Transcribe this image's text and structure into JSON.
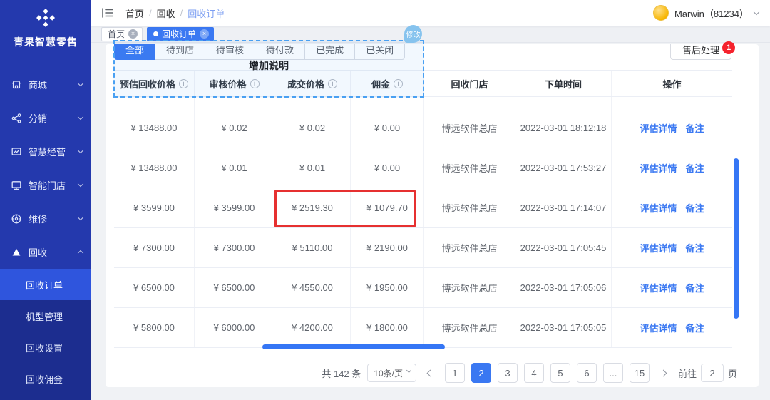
{
  "colors": {
    "accent": "#3a78f2",
    "sidebar_bg": "#2439ad",
    "sidebar_submenu_bg": "#1c2d8f",
    "sidebar_active_bg": "#2f55dd",
    "danger": "#f5222d",
    "annotation_blue": "#49a0f2",
    "annotation_red": "#e63030",
    "page_bg": "#f0f2f5"
  },
  "icons": {
    "close_glyph": "×",
    "info_glyph": "i"
  },
  "sidebar": {
    "brand": "青果智慧零售",
    "items": [
      {
        "label": "商城"
      },
      {
        "label": "分销"
      },
      {
        "label": "智慧经营"
      },
      {
        "label": "智能门店"
      },
      {
        "label": "维修"
      },
      {
        "label": "回收"
      }
    ],
    "submenu": [
      {
        "label": "回收订单"
      },
      {
        "label": "机型管理"
      },
      {
        "label": "回收设置"
      },
      {
        "label": "回收佣金"
      }
    ]
  },
  "topbar": {
    "breadcrumb": {
      "items": [
        "首页",
        "回收",
        "回收订单"
      ],
      "separator": "/"
    },
    "user_name": "Marwin（81234）"
  },
  "tags": [
    {
      "label": "首页"
    },
    {
      "label": "回收订单"
    }
  ],
  "toolbar": {
    "status_tabs": [
      "全部",
      "待到店",
      "待审核",
      "待付款",
      "已完成",
      "已关闭"
    ],
    "aftersale_label": "售后处理",
    "aftersale_badge": "1"
  },
  "annotation": {
    "tooltip_label": "增加说明",
    "badge_label": "修改"
  },
  "table": {
    "headers": [
      "预估回收价格",
      "审核价格",
      "成交价格",
      "佣金",
      "回收门店",
      "下单时间",
      "操作"
    ],
    "action_labels": [
      "评估详情",
      "备注"
    ],
    "rows": [
      {
        "estimate": "¥ 13488.00",
        "audit": "¥ 0.02",
        "deal": "¥ 0.02",
        "commission": "¥ 0.00",
        "store": "博远软件总店",
        "time": "2022-03-01 18:12:18"
      },
      {
        "estimate": "¥ 13488.00",
        "audit": "¥ 0.01",
        "deal": "¥ 0.01",
        "commission": "¥ 0.00",
        "store": "博远软件总店",
        "time": "2022-03-01 17:53:27"
      },
      {
        "estimate": "¥ 3599.00",
        "audit": "¥ 3599.00",
        "deal": "¥ 2519.30",
        "commission": "¥ 1079.70",
        "store": "博远软件总店",
        "time": "2022-03-01 17:14:07"
      },
      {
        "estimate": "¥ 7300.00",
        "audit": "¥ 7300.00",
        "deal": "¥ 5110.00",
        "commission": "¥ 2190.00",
        "store": "博远软件总店",
        "time": "2022-03-01 17:05:45"
      },
      {
        "estimate": "¥ 6500.00",
        "audit": "¥ 6500.00",
        "deal": "¥ 4550.00",
        "commission": "¥ 1950.00",
        "store": "博远软件总店",
        "time": "2022-03-01 17:05:06"
      },
      {
        "estimate": "¥ 5800.00",
        "audit": "¥ 6000.00",
        "deal": "¥ 4200.00",
        "commission": "¥ 1800.00",
        "store": "博远软件总店",
        "time": "2022-03-01 17:05:05"
      }
    ]
  },
  "pagination": {
    "total": "共 142 条",
    "page_size": "10条/页",
    "pages": [
      "1",
      "2",
      "3",
      "4",
      "5",
      "6",
      "...",
      "15"
    ],
    "active_page": "2",
    "goto_label": "前往",
    "goto_value": "2",
    "goto_suffix": "页"
  }
}
